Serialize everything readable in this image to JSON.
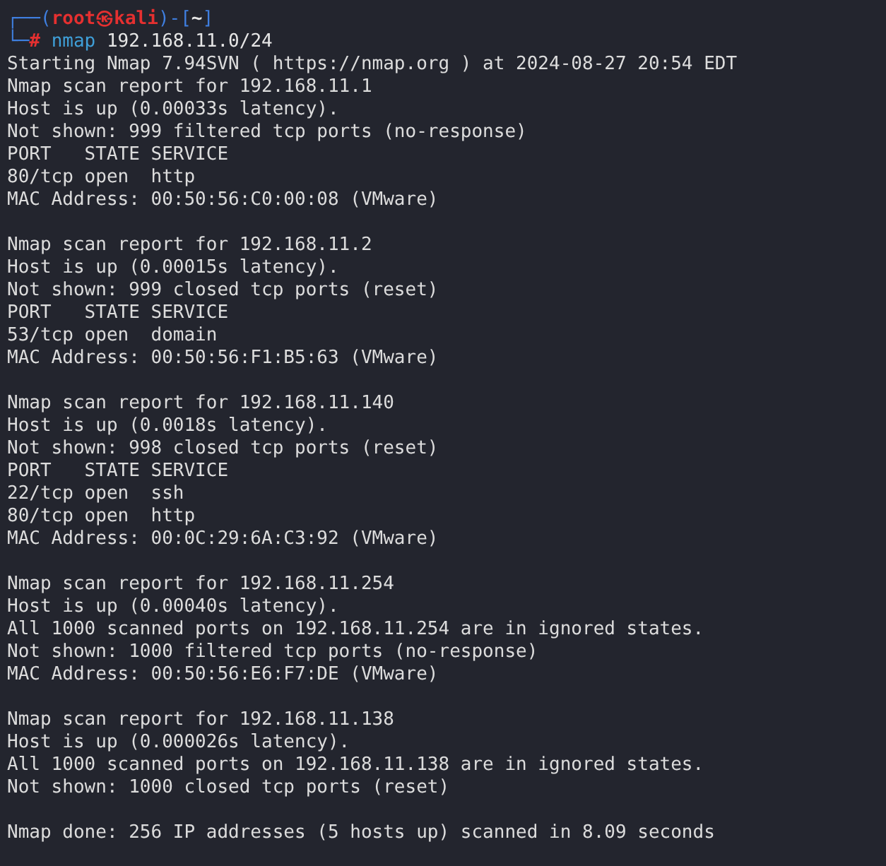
{
  "prompt": {
    "open": "┌──(",
    "user": "root",
    "at": "㉿",
    "host": "kali",
    "mid": ")-[",
    "dir": "~",
    "close": "]",
    "corner": "└─",
    "symbol": "#",
    "command": "nmap",
    "args": "192.168.11.0/24"
  },
  "output": [
    {
      "lines": [
        "Starting Nmap 7.94SVN ( https://nmap.org ) at 2024-08-27 20:54 EDT",
        "Nmap scan report for 192.168.11.1",
        "Host is up (0.00033s latency).",
        "Not shown: 999 filtered tcp ports (no-response)",
        "PORT   STATE SERVICE",
        "80/tcp open  http",
        "MAC Address: 00:50:56:C0:00:08 (VMware)"
      ]
    },
    {
      "lines": [
        "Nmap scan report for 192.168.11.2",
        "Host is up (0.00015s latency).",
        "Not shown: 999 closed tcp ports (reset)",
        "PORT   STATE SERVICE",
        "53/tcp open  domain",
        "MAC Address: 00:50:56:F1:B5:63 (VMware)"
      ]
    },
    {
      "lines": [
        "Nmap scan report for 192.168.11.140",
        "Host is up (0.0018s latency).",
        "Not shown: 998 closed tcp ports (reset)",
        "PORT   STATE SERVICE",
        "22/tcp open  ssh",
        "80/tcp open  http",
        "MAC Address: 00:0C:29:6A:C3:92 (VMware)"
      ]
    },
    {
      "lines": [
        "Nmap scan report for 192.168.11.254",
        "Host is up (0.00040s latency).",
        "All 1000 scanned ports on 192.168.11.254 are in ignored states.",
        "Not shown: 1000 filtered tcp ports (no-response)",
        "MAC Address: 00:50:56:E6:F7:DE (VMware)"
      ]
    },
    {
      "lines": [
        "Nmap scan report for 192.168.11.138",
        "Host is up (0.000026s latency).",
        "All 1000 scanned ports on 192.168.11.138 are in ignored states.",
        "Not shown: 1000 closed tcp ports (reset)"
      ]
    },
    {
      "lines": [
        "Nmap done: 256 IP addresses (5 hosts up) scanned in 8.09 seconds"
      ]
    }
  ]
}
